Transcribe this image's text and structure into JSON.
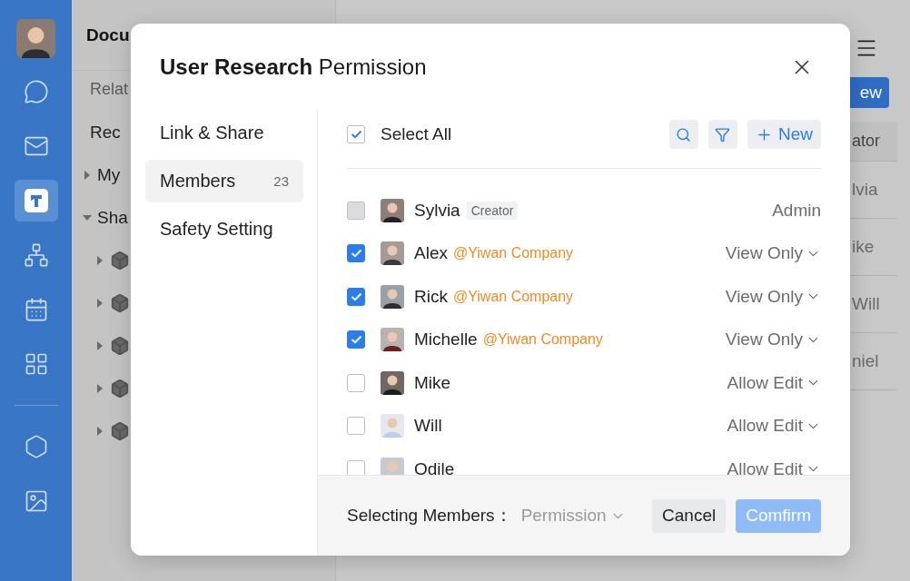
{
  "rail": {
    "items": [
      {
        "kind": "avatar",
        "selected": false
      },
      {
        "kind": "chat",
        "selected": false
      },
      {
        "kind": "mail",
        "selected": false
      },
      {
        "kind": "docs",
        "selected": true
      },
      {
        "kind": "org",
        "selected": false
      },
      {
        "kind": "calendar",
        "selected": false
      },
      {
        "kind": "apps",
        "selected": false
      },
      {
        "kind": "divider"
      },
      {
        "kind": "hexagon",
        "selected": false
      },
      {
        "kind": "gallery",
        "selected": false
      }
    ]
  },
  "panel": {
    "title": "Docu",
    "subtitle": "Relat",
    "items": [
      {
        "label": "Rec"
      },
      {
        "label": "My",
        "expanded": false
      },
      {
        "label": "Sha",
        "expanded": true,
        "children": [
          {
            "expanded": false
          },
          {
            "expanded": false
          },
          {
            "expanded": false
          },
          {
            "expanded": false
          },
          {
            "expanded": false
          }
        ]
      }
    ]
  },
  "main": {
    "new_button": "ew",
    "table": {
      "columns": [
        "ator"
      ],
      "rows": [
        "lvia",
        "ike",
        "Will",
        "niel"
      ]
    }
  },
  "dialog": {
    "title": "**User Research** Permission",
    "nav": [
      {
        "label": "Link & Share",
        "selected": false
      },
      {
        "label": "Members",
        "count": "23",
        "selected": true
      },
      {
        "label": "Safety Setting",
        "selected": false
      }
    ],
    "select_all": {
      "label": "Select All",
      "checked": true
    },
    "new_button": "New",
    "members": [
      {
        "name": "Sylvia",
        "tag": "Creator",
        "checked": false,
        "disabled": true,
        "permission": "Admin",
        "dropdown": false
      },
      {
        "name": "Alex",
        "company": "@Yiwan Company",
        "checked": true,
        "disabled": false,
        "permission": "View Only",
        "dropdown": true
      },
      {
        "name": "Rick",
        "company": "@Yiwan Company",
        "checked": true,
        "disabled": false,
        "permission": "View Only",
        "dropdown": true
      },
      {
        "name": "Michelle",
        "company": "@Yiwan Company",
        "checked": true,
        "disabled": false,
        "permission": "View Only",
        "dropdown": true
      },
      {
        "name": "Mike",
        "checked": false,
        "disabled": false,
        "permission": "Allow Edit",
        "dropdown": true
      },
      {
        "name": "Will",
        "checked": false,
        "disabled": false,
        "permission": "Allow Edit",
        "dropdown": true
      },
      {
        "name": "Odile",
        "checked": false,
        "disabled": false,
        "permission": "Allow Edit",
        "dropdown": true
      }
    ],
    "footer": {
      "label": "Selecting Members：",
      "permission": "Permission",
      "cancel": "Cancel",
      "confirm": "Comfirm",
      "confirm_disabled": true
    }
  }
}
